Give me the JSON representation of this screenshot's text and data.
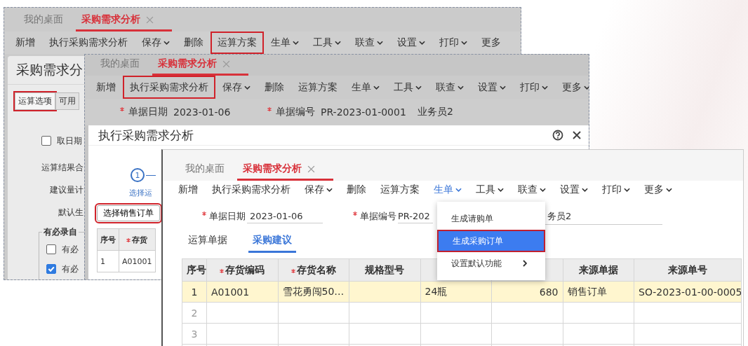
{
  "windows": [
    {
      "kind": "analysis-options",
      "tabs": [
        {
          "label": "我的桌面",
          "selected": false,
          "closable": false
        },
        {
          "label": "采购需求分析",
          "selected": true,
          "closable": true
        }
      ],
      "toolbar": [
        {
          "label": "新增",
          "dropdown": false,
          "highlighted": false,
          "active": false
        },
        {
          "label": "执行采购需求分析",
          "dropdown": false,
          "highlighted": false,
          "active": false
        },
        {
          "label": "保存",
          "dropdown": true,
          "highlighted": false,
          "active": false
        },
        {
          "label": "删除",
          "dropdown": false,
          "highlighted": false,
          "active": false
        },
        {
          "label": "运算方案",
          "dropdown": false,
          "highlighted": true,
          "active": false
        },
        {
          "label": "生单",
          "dropdown": true,
          "highlighted": false,
          "active": false
        },
        {
          "label": "工具",
          "dropdown": true,
          "highlighted": false,
          "active": false
        },
        {
          "label": "联查",
          "dropdown": true,
          "highlighted": false,
          "active": false
        },
        {
          "label": "设置",
          "dropdown": true,
          "highlighted": false,
          "active": false
        },
        {
          "label": "打印",
          "dropdown": true,
          "highlighted": false,
          "active": false
        },
        {
          "label": "更多",
          "dropdown": false,
          "highlighted": false,
          "active": false
        }
      ],
      "panel": {
        "title": "采购需求分",
        "tabs": [
          {
            "label": "运算选项",
            "selected": true,
            "highlighted": true
          },
          {
            "label": "可用",
            "selected": false,
            "highlighted": false
          }
        ],
        "options": [
          {
            "kind": "checkbox",
            "label": "取日期",
            "checked": false
          },
          {
            "kind": "label",
            "label": "运算结果合"
          },
          {
            "kind": "label",
            "label": "建议量计"
          },
          {
            "kind": "label",
            "label": "默认生"
          }
        ],
        "group": {
          "title": "有必录自",
          "items": [
            {
              "label": "有必",
              "checked": false
            },
            {
              "label": "有必",
              "checked": true
            }
          ]
        }
      }
    },
    {
      "kind": "analysis-dialog",
      "tabs": [
        {
          "label": "我的桌面",
          "selected": false,
          "closable": false
        },
        {
          "label": "采购需求分析",
          "selected": true,
          "closable": true
        }
      ],
      "toolbar": [
        {
          "label": "新增",
          "dropdown": false,
          "highlighted": false,
          "active": false
        },
        {
          "label": "执行采购需求分析",
          "dropdown": false,
          "highlighted": true,
          "active": false
        },
        {
          "label": "保存",
          "dropdown": true,
          "highlighted": false,
          "active": false
        },
        {
          "label": "删除",
          "dropdown": false,
          "highlighted": false,
          "active": false
        },
        {
          "label": "运算方案",
          "dropdown": false,
          "highlighted": false,
          "active": false
        },
        {
          "label": "生单",
          "dropdown": true,
          "highlighted": false,
          "active": false
        },
        {
          "label": "工具",
          "dropdown": true,
          "highlighted": false,
          "active": false
        },
        {
          "label": "联查",
          "dropdown": true,
          "highlighted": false,
          "active": false
        },
        {
          "label": "设置",
          "dropdown": true,
          "highlighted": false,
          "active": false
        },
        {
          "label": "打印",
          "dropdown": true,
          "highlighted": false,
          "active": false
        },
        {
          "label": "更多",
          "dropdown": true,
          "highlighted": false,
          "active": false
        }
      ],
      "fields": [
        {
          "label": "单据日期",
          "value": "2023-01-06",
          "required": true
        },
        {
          "label": "单据编号",
          "value": "PR-2023-01-0001",
          "required": true
        },
        {
          "value": "业务员2",
          "required": false
        }
      ],
      "dialog": {
        "title": "执行采购需求分析",
        "step": {
          "number": "1",
          "label": "选择运"
        },
        "select_button": {
          "label": "选择销售订单",
          "highlighted": true
        },
        "table": {
          "columns": [
            {
              "label": "序号",
              "required": false
            },
            {
              "label": "存货",
              "required": true
            }
          ],
          "rows": [
            [
              "1",
              "A01001"
            ]
          ]
        }
      }
    },
    {
      "kind": "purchase-suggestion",
      "tabs": [
        {
          "label": "我的桌面",
          "selected": false,
          "closable": false
        },
        {
          "label": "采购需求分析",
          "selected": true,
          "closable": true
        }
      ],
      "toolbar": [
        {
          "label": "新增",
          "dropdown": false,
          "highlighted": false,
          "active": false
        },
        {
          "label": "执行采购需求分析",
          "dropdown": false,
          "highlighted": false,
          "active": false
        },
        {
          "label": "保存",
          "dropdown": true,
          "highlighted": false,
          "active": false
        },
        {
          "label": "删除",
          "dropdown": false,
          "highlighted": false,
          "active": false
        },
        {
          "label": "运算方案",
          "dropdown": false,
          "highlighted": false,
          "active": false
        },
        {
          "label": "生单",
          "dropdown": true,
          "highlighted": false,
          "active": true
        },
        {
          "label": "工具",
          "dropdown": true,
          "highlighted": false,
          "active": false
        },
        {
          "label": "联查",
          "dropdown": true,
          "highlighted": false,
          "active": false
        },
        {
          "label": "设置",
          "dropdown": true,
          "highlighted": false,
          "active": false
        },
        {
          "label": "打印",
          "dropdown": true,
          "highlighted": false,
          "active": false
        },
        {
          "label": "更多",
          "dropdown": true,
          "highlighted": false,
          "active": false
        }
      ],
      "fields": [
        {
          "label": "单据日期",
          "value": "2023-01-06",
          "required": true
        },
        {
          "label": "单据编号",
          "value": "PR-202",
          "required": true
        },
        {
          "value": "务员2",
          "required": false
        }
      ],
      "subtabs": [
        {
          "label": "运算单据",
          "selected": false
        },
        {
          "label": "采购建议",
          "selected": true
        }
      ],
      "table": {
        "columns": [
          {
            "label": "序号",
            "required": false
          },
          {
            "label": "存货编码",
            "required": true
          },
          {
            "label": "存货名称",
            "required": true
          },
          {
            "label": "规格型号",
            "required": false
          },
          {},
          {
            "numeric": true
          },
          {
            "label": "来源单据",
            "required": false
          },
          {
            "label": "来源单号",
            "required": false
          }
        ],
        "rows": [
          {
            "number": "1",
            "selected": true,
            "cells": [
              "A01001",
              "雪花勇闯50…",
              null,
              "24瓶",
              "680",
              "销售订单",
              "SO-2023-01-00-0005"
            ]
          },
          {
            "number": "2",
            "selected": false
          },
          {
            "number": "3",
            "selected": false
          }
        ]
      },
      "menu": {
        "items": [
          {
            "label": "生成请购单",
            "selected": false,
            "highlighted": false,
            "submenu": false
          },
          {
            "label": "生成采购订单",
            "selected": true,
            "highlighted": true,
            "submenu": false
          },
          {
            "label": "设置默认功能",
            "selected": false,
            "highlighted": false,
            "submenu": true
          }
        ]
      }
    }
  ]
}
